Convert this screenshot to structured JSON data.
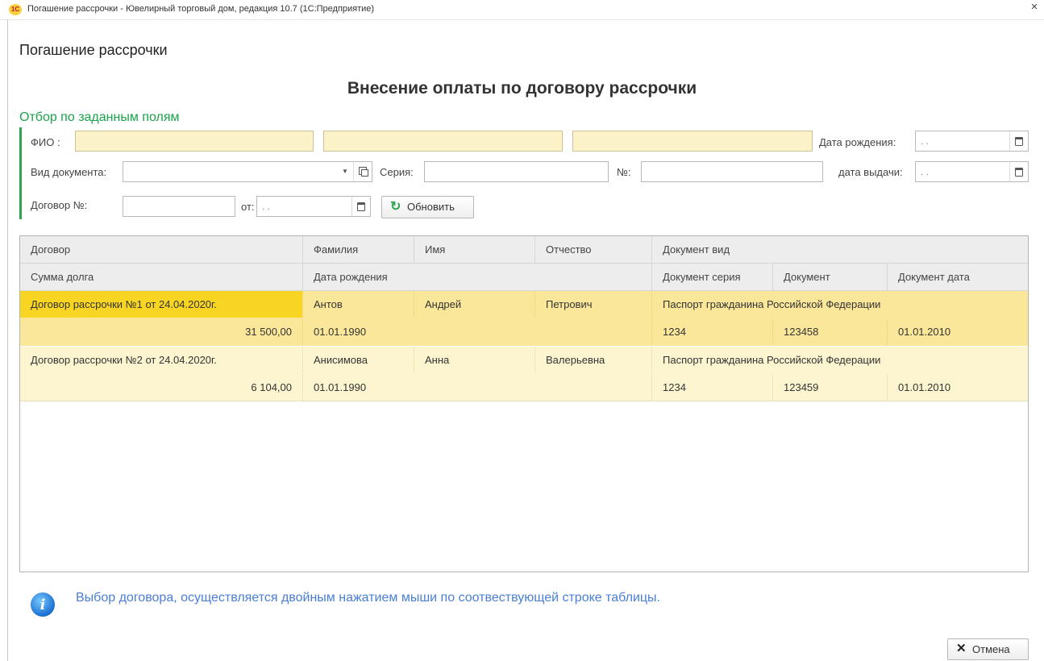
{
  "window": {
    "title": "Погашение рассрочки - Ювелирный торговый дом, редакция 10.7  (1С:Предприятие)",
    "logo_text": "1С",
    "close_glyph": "×"
  },
  "form": {
    "title": "Погашение рассрочки",
    "header": "Внесение оплаты по договору рассрочки"
  },
  "filter": {
    "title": "Отбор по заданным полям",
    "fio_label": "ФИО :",
    "birth_label": "Дата рождения:",
    "birth_value": " .  .",
    "doc_type_label": "Вид документа:",
    "series_label": "Серия:",
    "number_label": "№:",
    "issue_date_label": "дата выдачи:",
    "issue_date_value": " .  .",
    "contract_label": "Договор №:",
    "from_label": "от:",
    "from_value": " .  .",
    "refresh_label": "Обновить"
  },
  "table": {
    "header_row1": [
      "Договор",
      "Фамилия",
      "Имя",
      "Отчество",
      "Документ вид"
    ],
    "header_row2": [
      "Сумма долга",
      "Дата рождения",
      "Документ серия",
      "Документ",
      "Документ дата"
    ],
    "rows": [
      {
        "contract": "Договор рассрочки №1 от 24.04.2020г.",
        "surname": "Антов",
        "name": "Андрей",
        "patronymic": "Петрович",
        "doc_type": "Паспорт гражданина Российской Федерации",
        "debt": "31 500,00",
        "birth_date": "01.01.1990",
        "doc_series": "1234",
        "doc_number": "123458",
        "doc_date": "01.01.2010"
      },
      {
        "contract": "Договор рассрочки №2 от 24.04.2020г.",
        "surname": "Анисимова",
        "name": "Анна",
        "patronymic": "Валерьевна",
        "doc_type": "Паспорт гражданина Российской Федерации",
        "debt": "6 104,00",
        "birth_date": "01.01.1990",
        "doc_series": "1234",
        "doc_number": "123459",
        "doc_date": "01.01.2010"
      }
    ]
  },
  "info": {
    "icon": "info-icon",
    "text": "Выбор договора, осуществляется двойным нажатием мыши по соотвествующей строке таблицы."
  },
  "footer": {
    "cancel_label": "Отмена"
  },
  "colors": {
    "accent_green": "#2ea44f",
    "selected_row": "#fbe79a",
    "alt_row": "#fcf5d0",
    "focused_cell": "#f9d523",
    "info_text": "#4a7fd6"
  }
}
